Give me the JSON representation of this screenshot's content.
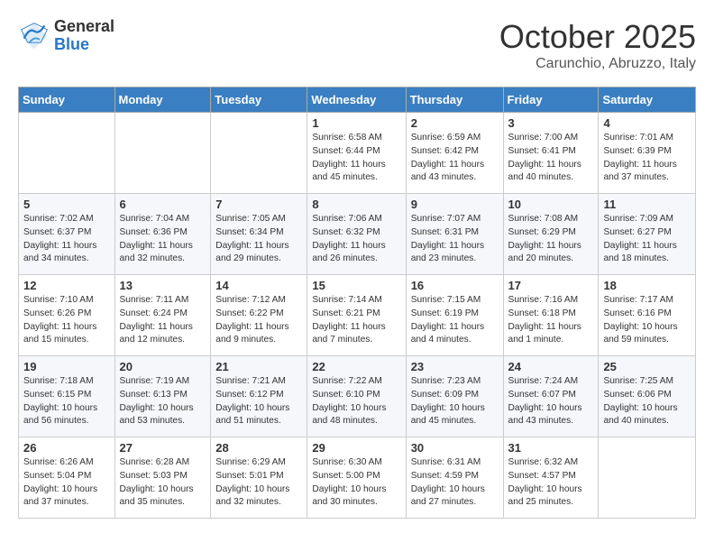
{
  "header": {
    "logo_general": "General",
    "logo_blue": "Blue",
    "month_title": "October 2025",
    "location": "Carunchio, Abruzzo, Italy"
  },
  "weekdays": [
    "Sunday",
    "Monday",
    "Tuesday",
    "Wednesday",
    "Thursday",
    "Friday",
    "Saturday"
  ],
  "weeks": [
    [
      {
        "day": "",
        "sunrise": "",
        "sunset": "",
        "daylight": ""
      },
      {
        "day": "",
        "sunrise": "",
        "sunset": "",
        "daylight": ""
      },
      {
        "day": "",
        "sunrise": "",
        "sunset": "",
        "daylight": ""
      },
      {
        "day": "1",
        "sunrise": "Sunrise: 6:58 AM",
        "sunset": "Sunset: 6:44 PM",
        "daylight": "Daylight: 11 hours and 45 minutes."
      },
      {
        "day": "2",
        "sunrise": "Sunrise: 6:59 AM",
        "sunset": "Sunset: 6:42 PM",
        "daylight": "Daylight: 11 hours and 43 minutes."
      },
      {
        "day": "3",
        "sunrise": "Sunrise: 7:00 AM",
        "sunset": "Sunset: 6:41 PM",
        "daylight": "Daylight: 11 hours and 40 minutes."
      },
      {
        "day": "4",
        "sunrise": "Sunrise: 7:01 AM",
        "sunset": "Sunset: 6:39 PM",
        "daylight": "Daylight: 11 hours and 37 minutes."
      }
    ],
    [
      {
        "day": "5",
        "sunrise": "Sunrise: 7:02 AM",
        "sunset": "Sunset: 6:37 PM",
        "daylight": "Daylight: 11 hours and 34 minutes."
      },
      {
        "day": "6",
        "sunrise": "Sunrise: 7:04 AM",
        "sunset": "Sunset: 6:36 PM",
        "daylight": "Daylight: 11 hours and 32 minutes."
      },
      {
        "day": "7",
        "sunrise": "Sunrise: 7:05 AM",
        "sunset": "Sunset: 6:34 PM",
        "daylight": "Daylight: 11 hours and 29 minutes."
      },
      {
        "day": "8",
        "sunrise": "Sunrise: 7:06 AM",
        "sunset": "Sunset: 6:32 PM",
        "daylight": "Daylight: 11 hours and 26 minutes."
      },
      {
        "day": "9",
        "sunrise": "Sunrise: 7:07 AM",
        "sunset": "Sunset: 6:31 PM",
        "daylight": "Daylight: 11 hours and 23 minutes."
      },
      {
        "day": "10",
        "sunrise": "Sunrise: 7:08 AM",
        "sunset": "Sunset: 6:29 PM",
        "daylight": "Daylight: 11 hours and 20 minutes."
      },
      {
        "day": "11",
        "sunrise": "Sunrise: 7:09 AM",
        "sunset": "Sunset: 6:27 PM",
        "daylight": "Daylight: 11 hours and 18 minutes."
      }
    ],
    [
      {
        "day": "12",
        "sunrise": "Sunrise: 7:10 AM",
        "sunset": "Sunset: 6:26 PM",
        "daylight": "Daylight: 11 hours and 15 minutes."
      },
      {
        "day": "13",
        "sunrise": "Sunrise: 7:11 AM",
        "sunset": "Sunset: 6:24 PM",
        "daylight": "Daylight: 11 hours and 12 minutes."
      },
      {
        "day": "14",
        "sunrise": "Sunrise: 7:12 AM",
        "sunset": "Sunset: 6:22 PM",
        "daylight": "Daylight: 11 hours and 9 minutes."
      },
      {
        "day": "15",
        "sunrise": "Sunrise: 7:14 AM",
        "sunset": "Sunset: 6:21 PM",
        "daylight": "Daylight: 11 hours and 7 minutes."
      },
      {
        "day": "16",
        "sunrise": "Sunrise: 7:15 AM",
        "sunset": "Sunset: 6:19 PM",
        "daylight": "Daylight: 11 hours and 4 minutes."
      },
      {
        "day": "17",
        "sunrise": "Sunrise: 7:16 AM",
        "sunset": "Sunset: 6:18 PM",
        "daylight": "Daylight: 11 hours and 1 minute."
      },
      {
        "day": "18",
        "sunrise": "Sunrise: 7:17 AM",
        "sunset": "Sunset: 6:16 PM",
        "daylight": "Daylight: 10 hours and 59 minutes."
      }
    ],
    [
      {
        "day": "19",
        "sunrise": "Sunrise: 7:18 AM",
        "sunset": "Sunset: 6:15 PM",
        "daylight": "Daylight: 10 hours and 56 minutes."
      },
      {
        "day": "20",
        "sunrise": "Sunrise: 7:19 AM",
        "sunset": "Sunset: 6:13 PM",
        "daylight": "Daylight: 10 hours and 53 minutes."
      },
      {
        "day": "21",
        "sunrise": "Sunrise: 7:21 AM",
        "sunset": "Sunset: 6:12 PM",
        "daylight": "Daylight: 10 hours and 51 minutes."
      },
      {
        "day": "22",
        "sunrise": "Sunrise: 7:22 AM",
        "sunset": "Sunset: 6:10 PM",
        "daylight": "Daylight: 10 hours and 48 minutes."
      },
      {
        "day": "23",
        "sunrise": "Sunrise: 7:23 AM",
        "sunset": "Sunset: 6:09 PM",
        "daylight": "Daylight: 10 hours and 45 minutes."
      },
      {
        "day": "24",
        "sunrise": "Sunrise: 7:24 AM",
        "sunset": "Sunset: 6:07 PM",
        "daylight": "Daylight: 10 hours and 43 minutes."
      },
      {
        "day": "25",
        "sunrise": "Sunrise: 7:25 AM",
        "sunset": "Sunset: 6:06 PM",
        "daylight": "Daylight: 10 hours and 40 minutes."
      }
    ],
    [
      {
        "day": "26",
        "sunrise": "Sunrise: 6:26 AM",
        "sunset": "Sunset: 5:04 PM",
        "daylight": "Daylight: 10 hours and 37 minutes."
      },
      {
        "day": "27",
        "sunrise": "Sunrise: 6:28 AM",
        "sunset": "Sunset: 5:03 PM",
        "daylight": "Daylight: 10 hours and 35 minutes."
      },
      {
        "day": "28",
        "sunrise": "Sunrise: 6:29 AM",
        "sunset": "Sunset: 5:01 PM",
        "daylight": "Daylight: 10 hours and 32 minutes."
      },
      {
        "day": "29",
        "sunrise": "Sunrise: 6:30 AM",
        "sunset": "Sunset: 5:00 PM",
        "daylight": "Daylight: 10 hours and 30 minutes."
      },
      {
        "day": "30",
        "sunrise": "Sunrise: 6:31 AM",
        "sunset": "Sunset: 4:59 PM",
        "daylight": "Daylight: 10 hours and 27 minutes."
      },
      {
        "day": "31",
        "sunrise": "Sunrise: 6:32 AM",
        "sunset": "Sunset: 4:57 PM",
        "daylight": "Daylight: 10 hours and 25 minutes."
      },
      {
        "day": "",
        "sunrise": "",
        "sunset": "",
        "daylight": ""
      }
    ]
  ]
}
